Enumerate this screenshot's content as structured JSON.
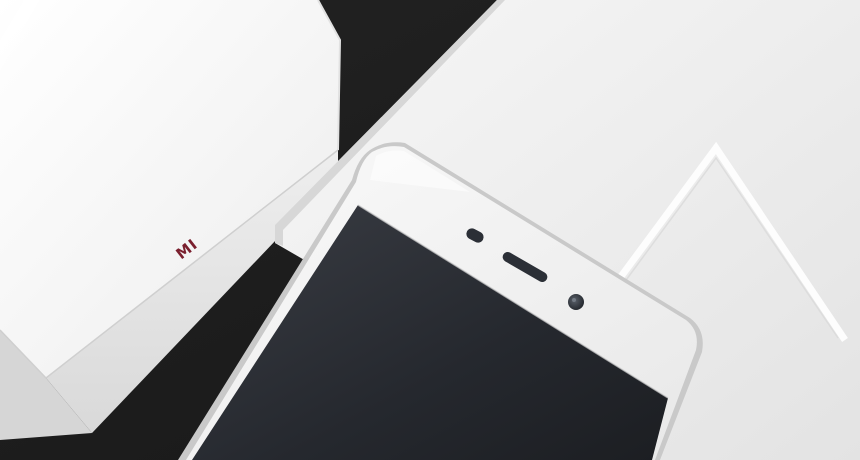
{
  "scene": {
    "background_color": "#1c1c1c",
    "left_box": {
      "logo_text": "MI",
      "logo_color": "#7a1f2e",
      "top_color": "#f7f7f7",
      "front_color": "#e6e6e6",
      "side_color": "#d8d8d8"
    },
    "right_box": {
      "surface_color": "#f2f2f2",
      "edge_color": "#dcdcdc",
      "embossed_shape": "triangle-outline"
    },
    "phone": {
      "body_color": "#f4f4f4",
      "frame_color": "#d9d9d9",
      "screen_color": "#2a2d34",
      "earpiece_color": "#2b2f36",
      "sensor_color": "#3a3f47",
      "camera_color": "#3c4149"
    }
  }
}
